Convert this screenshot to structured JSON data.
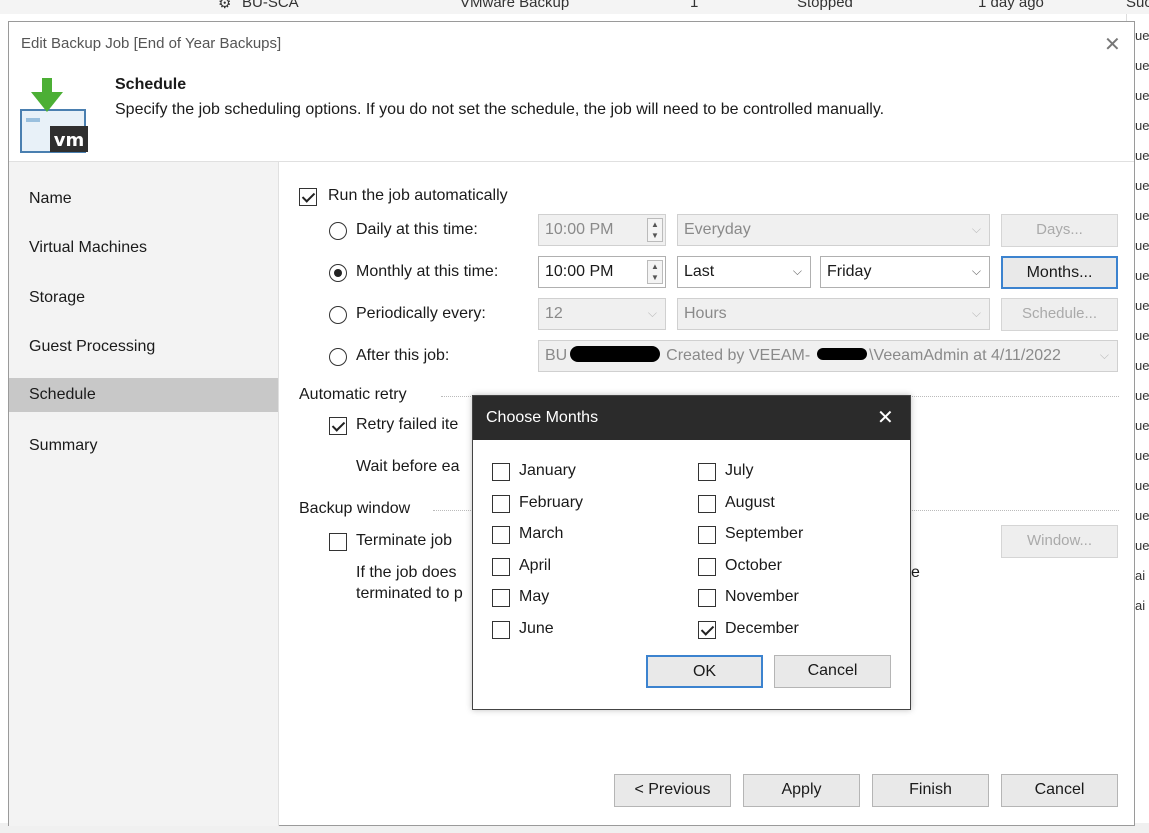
{
  "background": {
    "row": {
      "name": "BU-SCA",
      "type": "VMware Backup",
      "objects": "1",
      "status": "Stopped",
      "last_run": "1 day ago",
      "result": "Suc"
    },
    "right_fragments": [
      "ue",
      "ue",
      "ue",
      "ue",
      "ue",
      "ue",
      "ue",
      "ue",
      "ue",
      "ue",
      "ue",
      "ue",
      "ue",
      "ue",
      "ue",
      "ue",
      "ue",
      "ue",
      "ai",
      "ai"
    ]
  },
  "dialog": {
    "title": "Edit Backup Job [End of Year Backups]",
    "close_glyph": "✕",
    "header": {
      "title": "Schedule",
      "description": "Specify the job scheduling options. If you do not set the schedule, the job will need to be controlled manually.",
      "icon_label": "vm"
    },
    "nav": [
      "Name",
      "Virtual Machines",
      "Storage",
      "Guest Processing",
      "Schedule",
      "Summary"
    ],
    "schedule": {
      "run_auto_label": "Run the job automatically",
      "daily": {
        "label": "Daily at this time:",
        "time": "10:00 PM",
        "frequency": "Everyday",
        "button": "Days..."
      },
      "monthly": {
        "label": "Monthly at this time:",
        "time": "10:00 PM",
        "week": "Last",
        "day": "Friday",
        "button": "Months..."
      },
      "periodic": {
        "label": "Periodically every:",
        "value": "12",
        "unit": "Hours",
        "button": "Schedule..."
      },
      "after": {
        "label": "After this job:",
        "prefix": "BU",
        "value": "Created by VEEAM-",
        "suffix": "\\VeeamAdmin at 4/11/2022"
      },
      "retry_section": "Automatic retry",
      "retry_label": "Retry failed ite",
      "wait_label": "Wait before ea",
      "window_section": "Backup window",
      "terminate_label": "Terminate job",
      "window_button": "Window...",
      "info_line1": "If the job does",
      "info_line2": "terminated to p",
      "info_fragment": "e"
    },
    "buttons": {
      "previous": "< Previous",
      "apply": "Apply",
      "finish": "Finish",
      "cancel": "Cancel"
    }
  },
  "months_dialog": {
    "title": "Choose Months",
    "close_glyph": "✕",
    "months": [
      {
        "label": "January",
        "checked": false
      },
      {
        "label": "February",
        "checked": false
      },
      {
        "label": "March",
        "checked": false
      },
      {
        "label": "April",
        "checked": false
      },
      {
        "label": "May",
        "checked": false
      },
      {
        "label": "June",
        "checked": false
      },
      {
        "label": "July",
        "checked": false
      },
      {
        "label": "August",
        "checked": false
      },
      {
        "label": "September",
        "checked": false
      },
      {
        "label": "October",
        "checked": false
      },
      {
        "label": "November",
        "checked": false
      },
      {
        "label": "December",
        "checked": true
      }
    ],
    "ok": "OK",
    "cancel": "Cancel"
  }
}
